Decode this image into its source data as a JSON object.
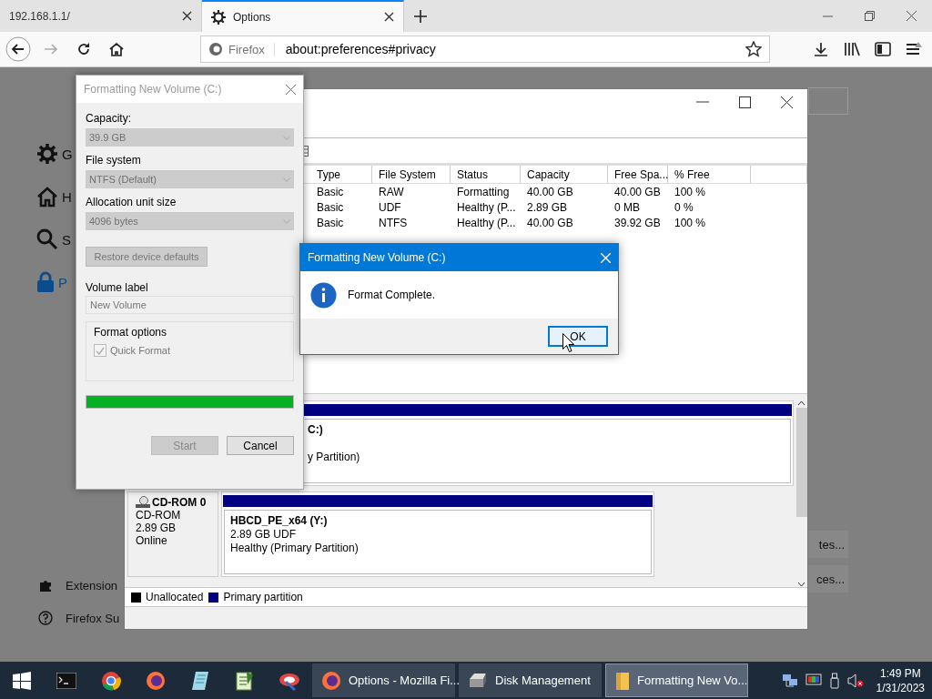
{
  "browser": {
    "tabs": [
      {
        "label": "192.168.1.1/",
        "selected": false
      },
      {
        "label": "Options",
        "selected": true
      }
    ],
    "identity": "Firefox",
    "url": "about:preferences#privacy"
  },
  "preferences": {
    "categories": [
      {
        "label": "G",
        "selected": false
      },
      {
        "label": "H",
        "selected": false
      },
      {
        "label": "S",
        "selected": false
      },
      {
        "label": "P",
        "selected": true
      }
    ],
    "footer": [
      "Extension",
      "Firefox Su"
    ],
    "buttons": [
      "tes...",
      "ces..."
    ]
  },
  "disk_management": {
    "columns": [
      "Type",
      "File System",
      "Status",
      "Capacity",
      "Free Spa...",
      "% Free"
    ],
    "rows": [
      {
        "cells": [
          "Basic",
          "RAW",
          "Formatting",
          "40.00 GB",
          "40.00 GB",
          "100 %"
        ]
      },
      {
        "cells": [
          "Basic",
          "UDF",
          "Healthy (P...",
          "2.89 GB",
          "0 MB",
          "0 %"
        ]
      },
      {
        "cells": [
          "Basic",
          "NTFS",
          "Healthy (P...",
          "40.00 GB",
          "39.92 GB",
          "100 %"
        ]
      }
    ],
    "disks": [
      {
        "partition": {
          "title": "C:)",
          "status": "y Partition)"
        }
      },
      {
        "name": "CD-ROM 0",
        "type": "CD-ROM",
        "size": "2.89 GB",
        "state": "Online",
        "partition": {
          "title": "HBCD_PE_x64 (Y:)",
          "detail": "2.89 GB UDF",
          "status": "Healthy (Primary Partition)"
        }
      }
    ],
    "legend": [
      {
        "label": "Unallocated",
        "color": "#000000"
      },
      {
        "label": "Primary partition",
        "color": "#000080"
      }
    ]
  },
  "format_dialog": {
    "title": "Formatting New Volume (C:)",
    "fields": [
      {
        "label": "Capacity:",
        "value": "39.9 GB",
        "disabled": true
      },
      {
        "label": "File system",
        "value": "NTFS (Default)",
        "disabled": true
      },
      {
        "label": "Allocation unit size",
        "value": "4096 bytes",
        "disabled": true
      }
    ],
    "restore_button": {
      "label": "Restore device defaults",
      "disabled": true
    },
    "volume_label": {
      "label": "Volume label",
      "value": "New Volume",
      "disabled": true
    },
    "format_options": {
      "title": "Format options",
      "quick_format": {
        "label": "Quick Format",
        "checked": true
      }
    },
    "progress": {
      "level": 1
    },
    "buttons": [
      {
        "label": "Start",
        "disabled": true
      },
      {
        "label": "Cancel",
        "disabled": false
      }
    ]
  },
  "message_box": {
    "title": "Formatting New Volume (C:)",
    "message": "Format Complete.",
    "button": "OK"
  },
  "taskbar": {
    "tasks": [
      {
        "label": "Options - Mozilla Fi...",
        "selected": false,
        "kind": "firefox"
      },
      {
        "label": "Disk Management",
        "selected": false,
        "kind": "disk"
      },
      {
        "label": "Formatting New Vo...",
        "selected": true,
        "kind": "folder"
      }
    ],
    "time": "1:49 PM",
    "date": "1/31/2023"
  }
}
